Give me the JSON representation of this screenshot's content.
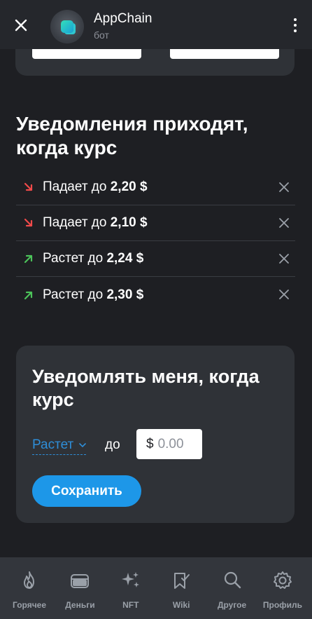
{
  "header": {
    "title": "AppChain",
    "subtitle": "бот"
  },
  "alerts_section": {
    "title": "Уведомления приходят, когда курс",
    "items": [
      {
        "text": "Падает до",
        "value": "2,20 $",
        "direction": "down",
        "color": "#f04a4a"
      },
      {
        "text": "Падает до",
        "value": "2,10 $",
        "direction": "down",
        "color": "#f04a4a"
      },
      {
        "text": "Растет до",
        "value": "2,24 $",
        "direction": "up",
        "color": "#4cc35a"
      },
      {
        "text": "Растет до",
        "value": "2,30 $",
        "direction": "up",
        "color": "#4cc35a"
      }
    ]
  },
  "notify_card": {
    "title": "Уведомлять меня, когда курс",
    "direction_selected": "Растет",
    "to_label": "до",
    "price_prefix": "$",
    "price_placeholder": "0.00",
    "save_label": "Сохранить"
  },
  "bottom_nav": [
    {
      "label": "Горячее",
      "icon": "flame-icon"
    },
    {
      "label": "Деньги",
      "icon": "wallet-icon"
    },
    {
      "label": "NFT",
      "icon": "sparkles-icon"
    },
    {
      "label": "Wiki",
      "icon": "bookmark-icon"
    },
    {
      "label": "Другое",
      "icon": "search-icon"
    },
    {
      "label": "Профиль",
      "icon": "gear-icon"
    }
  ],
  "colors": {
    "accent": "#1d97e8",
    "background": "#1e1f23",
    "card": "#2f3237",
    "down": "#f04a4a",
    "up": "#4cc35a"
  }
}
